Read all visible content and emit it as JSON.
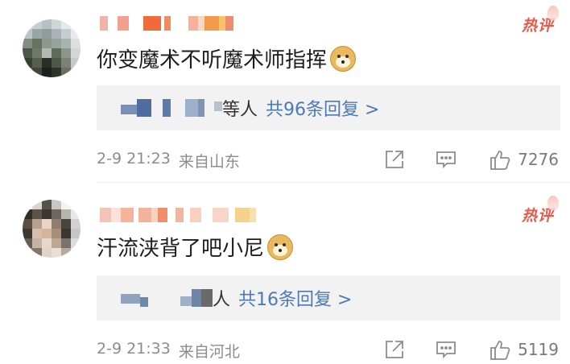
{
  "comments": [
    {
      "hot_label": "热评",
      "text": "你变魔术不听魔术师指挥",
      "emoji": "doge-icon",
      "replies": {
        "suffix": "等人",
        "link": "共96条回复 >"
      },
      "date": "2-9 21:23",
      "location": "来自山东",
      "likes": "7276"
    },
    {
      "hot_label": "热评",
      "text": "汗流浃背了吧小尼",
      "emoji": "doge-icon",
      "replies": {
        "suffix": "人",
        "link": "共16条回复 >"
      },
      "date": "2-9 21:33",
      "location": "来自河北",
      "likes": "5119"
    }
  ],
  "colors": {
    "hot": "#e8594a",
    "link": "#4a7ab8",
    "meta": "#8c8c8c",
    "reply_box": "#f2f2f2"
  }
}
